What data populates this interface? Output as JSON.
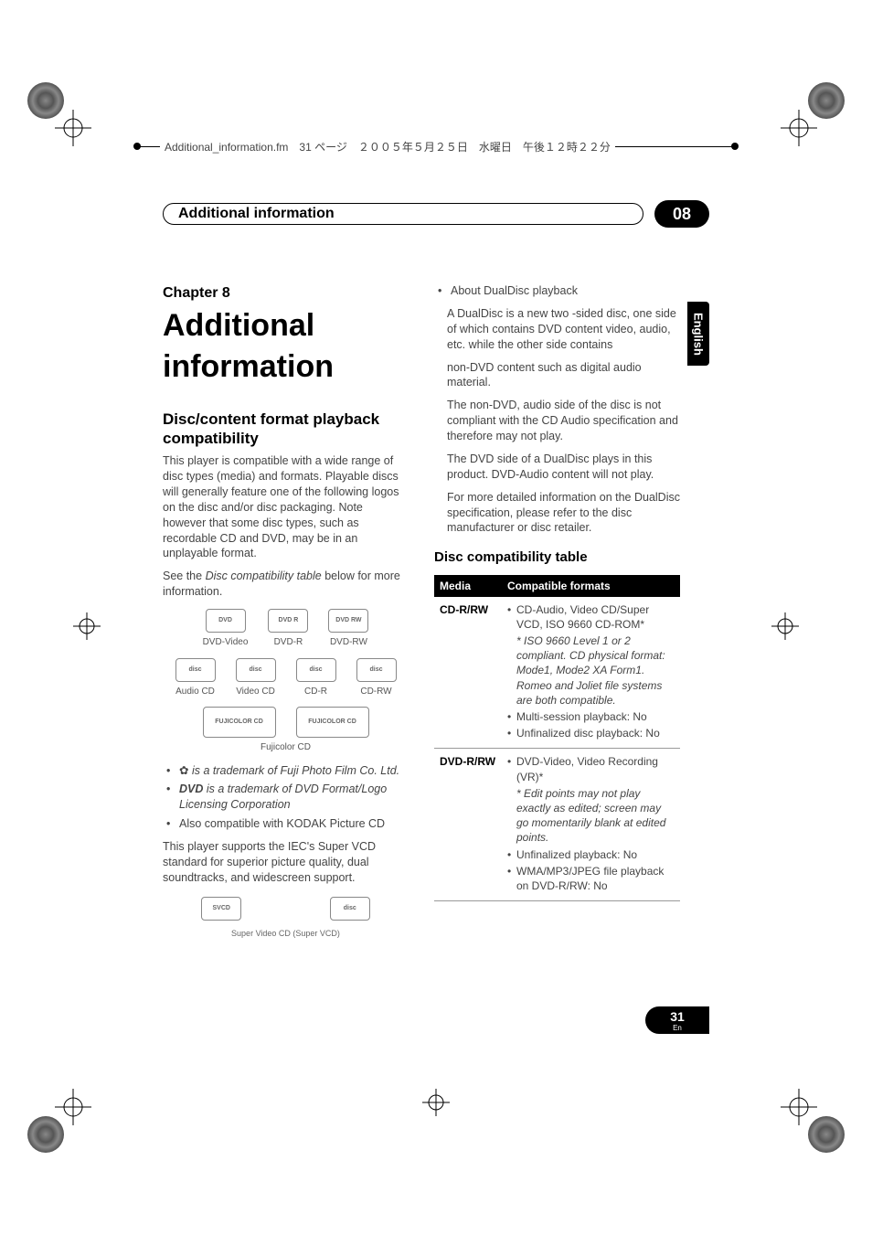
{
  "header_text": "Additional_information.fm　31 ページ　２００５年５月２５日　水曜日　午後１２時２２分",
  "section_header": {
    "title": "Additional information",
    "number": "08"
  },
  "side_tab": "English",
  "chapter": {
    "label": "Chapter 8",
    "title": "Additional information"
  },
  "left": {
    "heading": "Disc/content format playback compatibility",
    "p1": "This player is compatible with a wide range of disc types (media) and formats. Playable discs will generally feature one of the following logos on the disc and/or disc packaging. Note however that some disc types, such as recordable CD and DVD, may be in an unplayable format.",
    "p2a": "See the ",
    "p2b_italic": "Disc compatibility table",
    "p2c": " below for more information.",
    "logos_row1": [
      "DVD-Video",
      "DVD-R",
      "DVD-RW"
    ],
    "logos_row2": [
      "Audio CD",
      "Video CD",
      "CD-R",
      "CD-RW"
    ],
    "logos_row3_caption": "Fujicolor CD",
    "bullets": [
      " is a trademark of Fuji Photo Film Co. Ltd.",
      " is a trademark of DVD Format/Logo Licensing Corporation",
      "Also compatible with KODAK Picture CD"
    ],
    "svcd_p": "This player supports the IEC's Super VCD standard for superior picture quality, dual soundtracks, and widescreen support.",
    "svcd_caption": "Super Video CD (Super VCD)"
  },
  "right": {
    "bullet_title": "About DualDisc playback",
    "p1": "A DualDisc is a new two -sided disc, one side of which contains DVD content video, audio, etc. while the other side contains",
    "p2": "non-DVD content such as digital audio material.",
    "p3": "The non-DVD, audio side of the disc is not compliant with the CD Audio specification and therefore may not play.",
    "p4": "The DVD side of a DualDisc plays in this product. DVD-Audio content will not play.",
    "p5": "For more detailed information on the DualDisc specification, please refer to the disc manufacturer or disc retailer.",
    "table_heading": "Disc compatibility table",
    "table": {
      "headers": [
        "Media",
        "Compatible formats"
      ],
      "rows": [
        {
          "media": "CD-R/RW",
          "lines": [
            {
              "b": true,
              "t": "CD-Audio, Video CD/Super VCD, ISO 9660 CD-ROM*"
            },
            {
              "b": false,
              "italic": true,
              "t": "* ISO 9660 Level 1 or 2 compliant. CD physical format: Mode1, Mode2 XA Form1. Romeo and Joliet file systems are both compatible."
            },
            {
              "b": true,
              "t": "Multi-session playback: No"
            },
            {
              "b": true,
              "t": "Unfinalized disc playback: No"
            }
          ]
        },
        {
          "media": "DVD-R/RW",
          "lines": [
            {
              "b": true,
              "t": "DVD-Video, Video Recording (VR)*"
            },
            {
              "b": false,
              "italic": true,
              "t": "* Edit points may not play exactly as edited; screen may go momentarily blank at edited points."
            },
            {
              "b": true,
              "t": "Unfinalized playback: No"
            },
            {
              "b": true,
              "t": "WMA/MP3/JPEG file playback on DVD-R/RW: No"
            }
          ]
        }
      ]
    }
  },
  "footer": {
    "page": "31",
    "lang": "En"
  }
}
